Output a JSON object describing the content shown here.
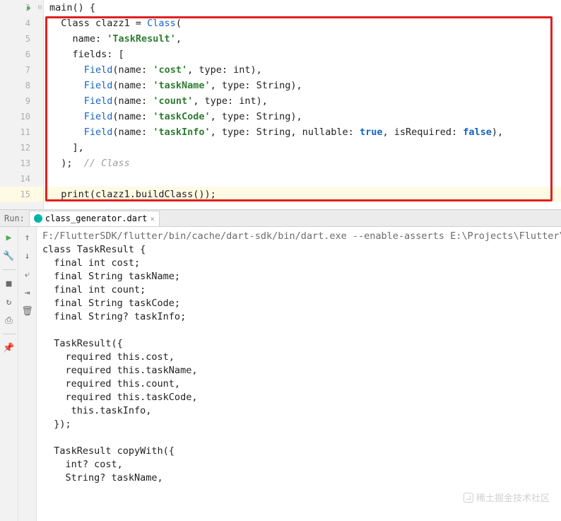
{
  "editor": {
    "lines": [
      {
        "num": "3",
        "has_run": true,
        "fold": "-"
      },
      {
        "num": "4"
      },
      {
        "num": "5"
      },
      {
        "num": "6"
      },
      {
        "num": "7"
      },
      {
        "num": "8"
      },
      {
        "num": "9"
      },
      {
        "num": "10"
      },
      {
        "num": "11"
      },
      {
        "num": "12"
      },
      {
        "num": "13"
      },
      {
        "num": "14"
      },
      {
        "num": "15"
      }
    ],
    "code": {
      "l3": "main() {",
      "l4_pre": "  Class clazz1 = ",
      "l4_class": "Class",
      "l4_post": "(",
      "l5_pre": "    name: ",
      "l5_str": "'TaskResult'",
      "l5_post": ",",
      "l6": "    fields: [",
      "l7_pre": "      ",
      "l7_field": "Field",
      "l7_mid": "(name: ",
      "l7_str": "'cost'",
      "l7_post": ", type: int),",
      "l8_pre": "      ",
      "l8_field": "Field",
      "l8_mid": "(name: ",
      "l8_str": "'taskName'",
      "l8_post": ", type: String),",
      "l9_pre": "      ",
      "l9_field": "Field",
      "l9_mid": "(name: ",
      "l9_str": "'count'",
      "l9_post": ", type: int),",
      "l10_pre": "      ",
      "l10_field": "Field",
      "l10_mid": "(name: ",
      "l10_str": "'taskCode'",
      "l10_post": ", type: String),",
      "l11_pre": "      ",
      "l11_field": "Field",
      "l11_mid": "(name: ",
      "l11_str": "'taskInfo'",
      "l11_mid2": ", type: String, nullable: ",
      "l11_true": "true",
      "l11_mid3": ", isRequired: ",
      "l11_false": "false",
      "l11_post": "),",
      "l12": "    ],",
      "l13_pre": "  );  ",
      "l13_comment": "// Class",
      "l14": "",
      "l15": "  print(clazz1.buildClass());"
    }
  },
  "run": {
    "panel_label": "Run:",
    "tab_name": "class_generator.dart",
    "console": {
      "path": "F:/FlutterSDK/flutter/bin/cache/dart-sdk/bin/dart.exe --enable-asserts E:\\Projects\\Flutter\\",
      "out01": "class TaskResult {",
      "out02": "  final int cost;",
      "out03": "  final String taskName;",
      "out04": "  final int count;",
      "out05": "  final String taskCode;",
      "out06": "  final String? taskInfo;",
      "out07": "",
      "out08": "  TaskResult({",
      "out09": "    required this.cost,",
      "out10": "    required this.taskName,",
      "out11": "    required this.count,",
      "out12": "    required this.taskCode,",
      "out13": "     this.taskInfo,",
      "out14": "  });",
      "out15": "",
      "out16": "  TaskResult copyWith({",
      "out17": "    int? cost,",
      "out18": "    String? taskName,"
    }
  },
  "icons": {
    "play": "▶",
    "wrench": "🔧",
    "stop": "■",
    "restart": "⟲",
    "print": "🖨",
    "pin": "📌",
    "up": "↑",
    "down": "↓",
    "wrap": "↩",
    "filter": "≡",
    "trash": "🗑"
  },
  "watermark": "稀土掘金技术社区"
}
